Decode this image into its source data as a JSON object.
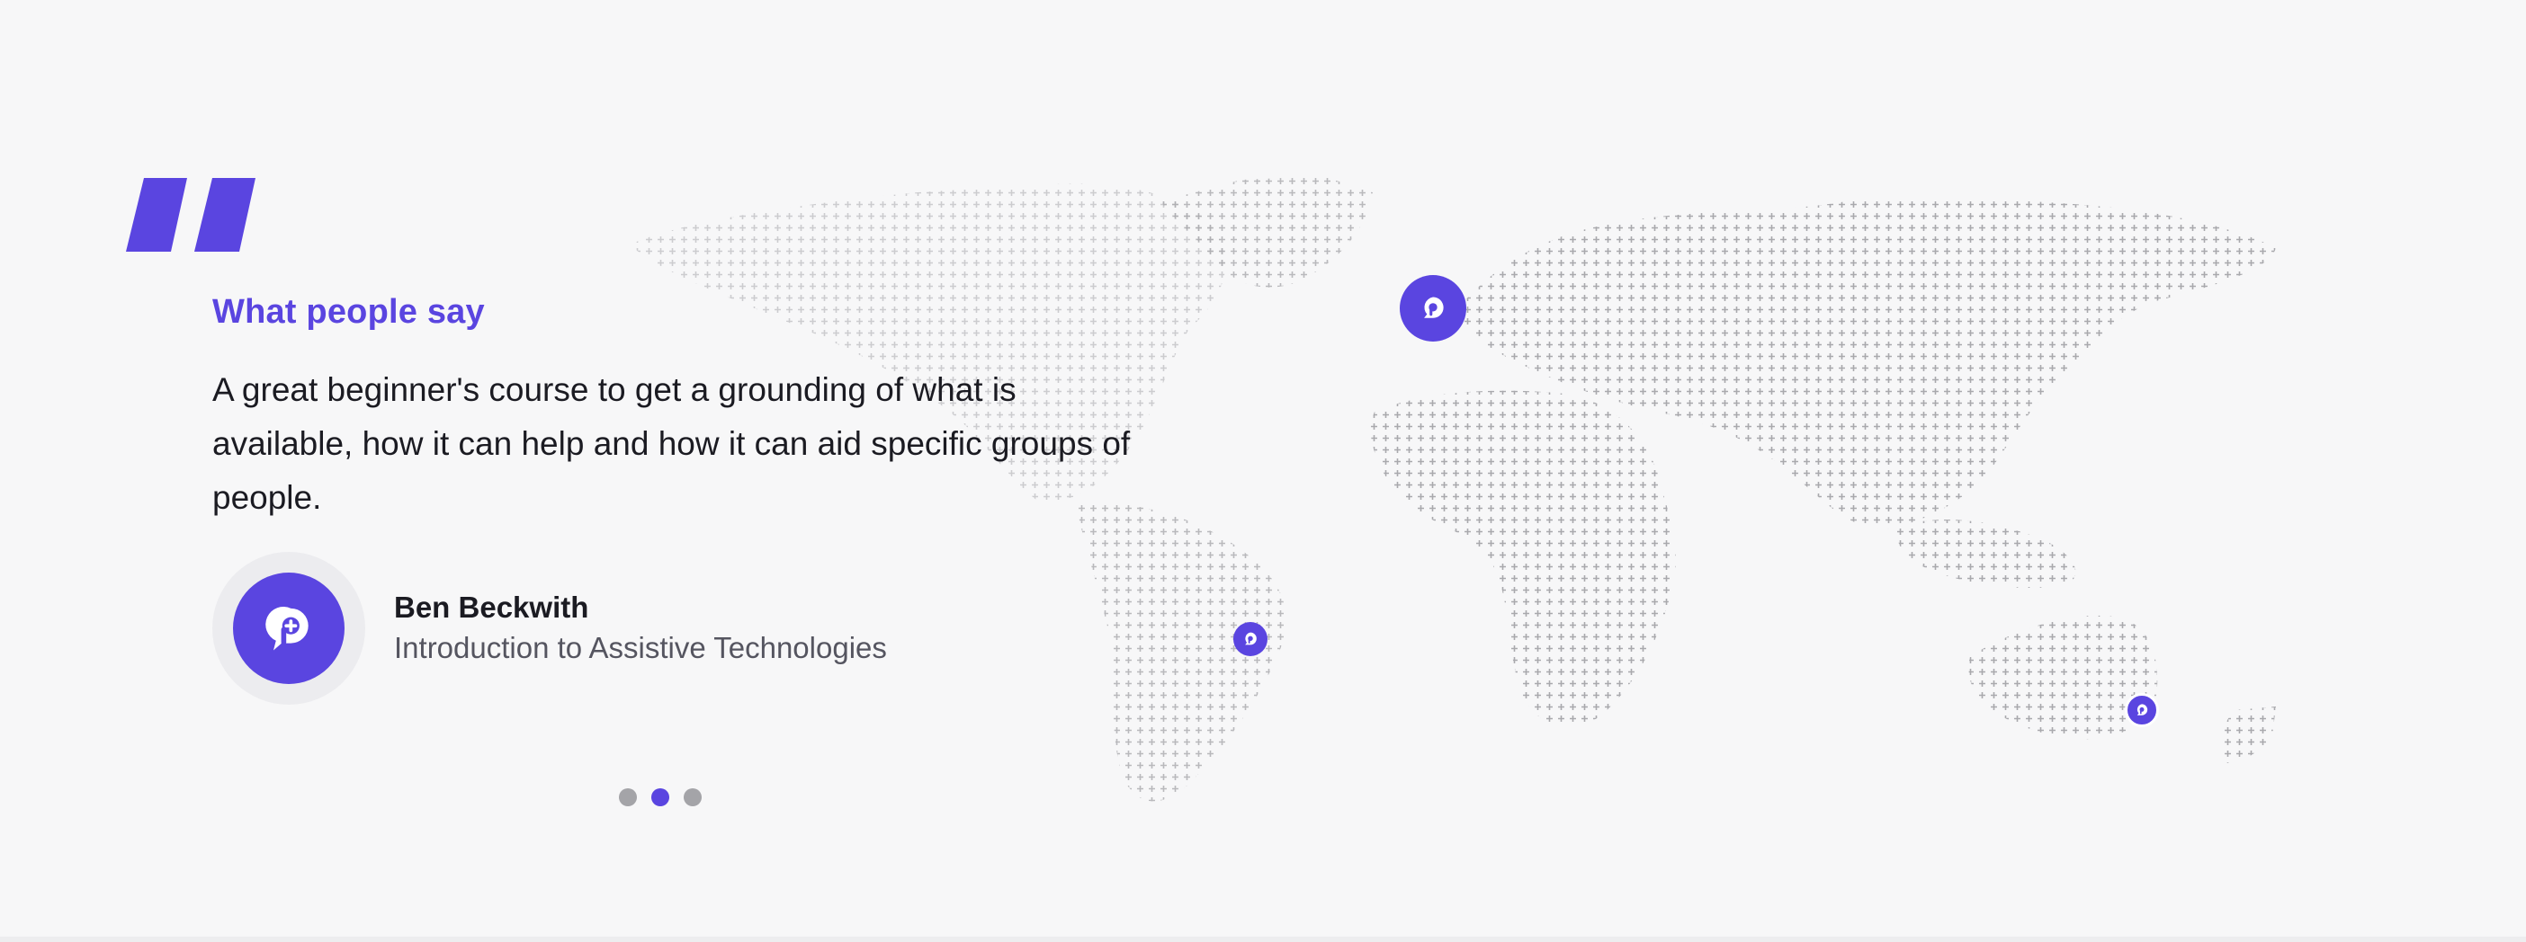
{
  "testimonial": {
    "heading": "What people say",
    "quote": "A great beginner's course to get a grounding of what is available, how it can help and how it can aid specific groups of people.",
    "author_name": "Ben Beckwith",
    "author_course": "Introduction to Assistive Technologies"
  },
  "carousel": {
    "slide_count": 3,
    "active_index": 1
  },
  "colors": {
    "brand": "#5a45e0",
    "map_marks": "#a9a9ad",
    "background": "#f7f7f8",
    "dot_inactive": "#a4a4a8"
  },
  "icons": {
    "quote": "quote-icon",
    "avatar": "chat-plus-icon",
    "pin": "brand-pin-icon"
  }
}
